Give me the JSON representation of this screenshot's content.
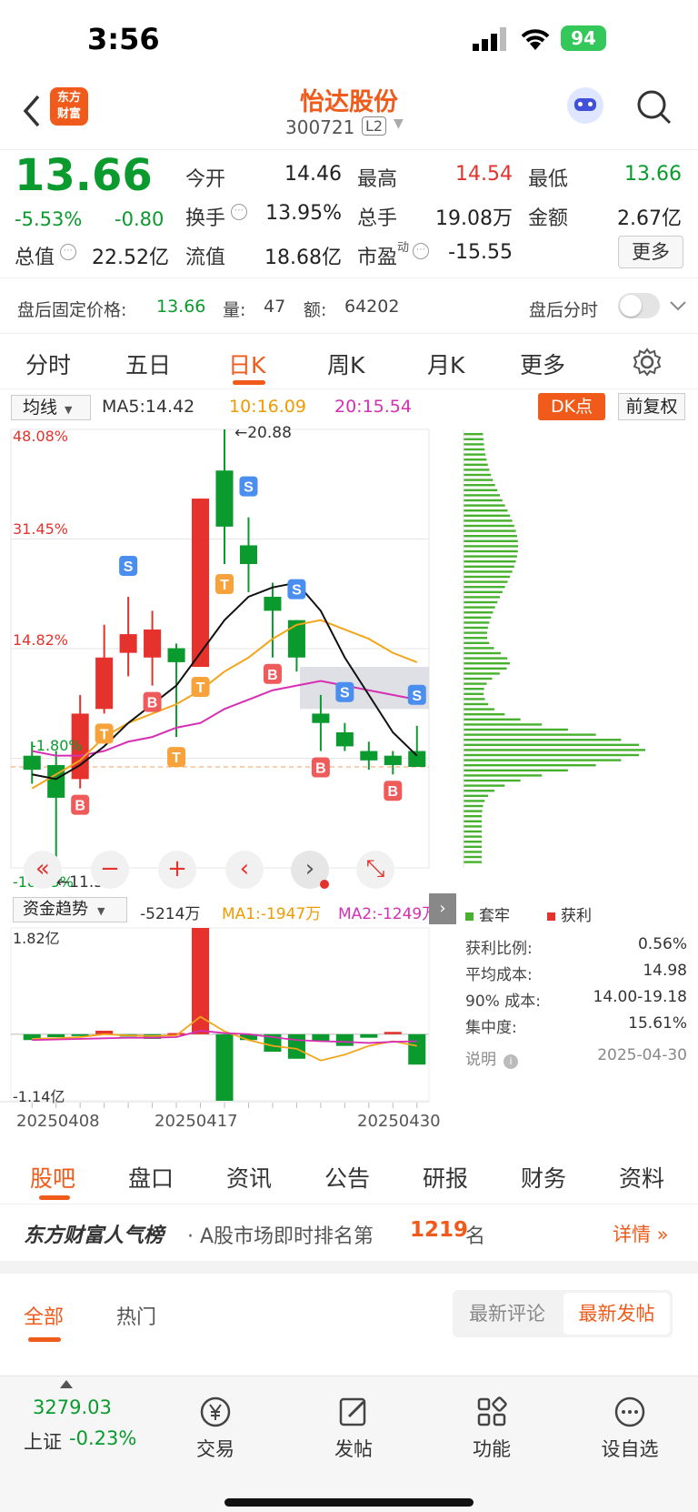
{
  "status_bar": {
    "time": "3:56",
    "battery": "94"
  },
  "header": {
    "brand_line1": "东方",
    "brand_line2": "财富",
    "stock_name": "怡达股份",
    "stock_code": "300721",
    "level_badge": "L2"
  },
  "quote": {
    "price": "13.66",
    "change_pct": "-5.53%",
    "change": "-0.80",
    "market_cap_label": "总值",
    "market_cap": "22.52亿",
    "rows": [
      [
        {
          "label": "今开",
          "value": "14.46",
          "color": "normal"
        },
        {
          "label": "最高",
          "value": "14.54",
          "color": "red"
        },
        {
          "label": "最低",
          "value": "13.66",
          "color": "green"
        }
      ],
      [
        {
          "label": "换手",
          "value": "13.95%",
          "color": "normal"
        },
        {
          "label": "总手",
          "value": "19.08万",
          "color": "normal"
        },
        {
          "label": "金额",
          "value": "2.67亿",
          "color": "normal"
        }
      ],
      [
        {
          "label": "流值",
          "value": "18.68亿",
          "color": "normal"
        },
        {
          "label": "市盈",
          "value": "-15.55",
          "color": "normal"
        }
      ]
    ],
    "pe_super": "动",
    "more_button": "更多"
  },
  "after_hours": {
    "label": "盘后固定价格:",
    "price": "13.66",
    "vol_label": "量:",
    "vol": "47",
    "amt_label": "额:",
    "amt": "64202",
    "time_label": "盘后分时"
  },
  "period_tabs": [
    "分时",
    "五日",
    "日K",
    "周K",
    "月K",
    "更多"
  ],
  "active_period": "日K",
  "indicators": {
    "ma_select": "均线",
    "ma5": "MA5:14.42",
    "ma10": "10:16.09",
    "ma20": "20:15.54",
    "dk_button": "DK点",
    "adjust_button": "前复权"
  },
  "kline_axis": {
    "top_pct": "48.08%",
    "pct2": "31.45%",
    "pct3": "14.82%",
    "pct4": "-1.80%",
    "bottom_pct": "-18.43%",
    "high_label": "←20.88",
    "low_label": "←11.50"
  },
  "chart_data": {
    "type": "candlestick",
    "candles": [
      {
        "o": 13.9,
        "c": 13.6,
        "h": 14.2,
        "l": 13.3
      },
      {
        "o": 13.7,
        "c": 13.0,
        "h": 14.0,
        "l": 11.5
      },
      {
        "o": 13.4,
        "c": 14.8,
        "h": 15.2,
        "l": 13.2
      },
      {
        "o": 14.9,
        "c": 16.0,
        "h": 16.7,
        "l": 14.8
      },
      {
        "o": 16.1,
        "c": 16.5,
        "h": 17.3,
        "l": 15.6
      },
      {
        "o": 16.0,
        "c": 16.6,
        "h": 17.0,
        "l": 15.4
      },
      {
        "o": 16.2,
        "c": 15.9,
        "h": 16.3,
        "l": 14.3
      },
      {
        "o": 15.8,
        "c": 19.4,
        "h": 19.4,
        "l": 15.8
      },
      {
        "o": 20.0,
        "c": 18.8,
        "h": 20.88,
        "l": 18.0
      },
      {
        "o": 18.4,
        "c": 18.0,
        "h": 19.0,
        "l": 17.4
      },
      {
        "o": 17.3,
        "c": 17.0,
        "h": 17.6,
        "l": 16.0
      },
      {
        "o": 16.8,
        "c": 16.0,
        "h": 16.8,
        "l": 15.7
      },
      {
        "o": 14.8,
        "c": 14.6,
        "h": 15.2,
        "l": 14.0
      },
      {
        "o": 14.4,
        "c": 14.1,
        "h": 14.6,
        "l": 14.0
      },
      {
        "o": 14.0,
        "c": 13.8,
        "h": 14.2,
        "l": 13.6
      },
      {
        "o": 13.9,
        "c": 13.7,
        "h": 14.0,
        "l": 13.5
      },
      {
        "o": 14.0,
        "c": 13.66,
        "h": 14.54,
        "l": 13.66
      }
    ],
    "ma5": [
      13.5,
      13.4,
      13.7,
      14.1,
      14.6,
      15.0,
      15.4,
      16.1,
      16.8,
      17.3,
      17.5,
      17.6,
      17.0,
      16.0,
      15.2,
      14.4,
      13.9
    ],
    "ma10": [
      13.2,
      13.5,
      13.8,
      14.3,
      14.6,
      14.8,
      15.0,
      15.3,
      15.7,
      16.0,
      16.4,
      16.7,
      16.8,
      16.6,
      16.4,
      16.1,
      15.9
    ],
    "ma20": [
      14.0,
      13.9,
      13.9,
      14.0,
      14.2,
      14.3,
      14.5,
      14.6,
      14.9,
      15.1,
      15.3,
      15.4,
      15.5,
      15.4,
      15.3,
      15.2,
      15.1
    ],
    "markers": [
      {
        "i": 4,
        "t": "S"
      },
      {
        "i": 9,
        "t": "S"
      },
      {
        "i": 11,
        "t": "S"
      },
      {
        "i": 13,
        "t": "S"
      },
      {
        "i": 16,
        "t": "S"
      },
      {
        "i": 2,
        "t": "B"
      },
      {
        "i": 5,
        "t": "B"
      },
      {
        "i": 10,
        "t": "B"
      },
      {
        "i": 12,
        "t": "B"
      },
      {
        "i": 15,
        "t": "B"
      },
      {
        "i": 3,
        "t": "T"
      },
      {
        "i": 6,
        "t": "T"
      },
      {
        "i": 7,
        "t": "T"
      },
      {
        "i": 8,
        "t": "T"
      }
    ],
    "fund_flow": [
      {
        "v": -0.1
      },
      {
        "v": -0.05
      },
      {
        "v": -0.02
      },
      {
        "v": 0.06
      },
      {
        "v": -0.04
      },
      {
        "v": -0.08
      },
      {
        "v": 0.02
      },
      {
        "v": 1.82
      },
      {
        "v": -1.14
      },
      {
        "v": -0.1
      },
      {
        "v": -0.3
      },
      {
        "v": -0.42
      },
      {
        "v": -0.12
      },
      {
        "v": -0.2
      },
      {
        "v": -0.06
      },
      {
        "v": 0.04
      },
      {
        "v": -0.52
      }
    ],
    "fund_ma1": [
      -0.08,
      -0.07,
      -0.05,
      0.0,
      -0.02,
      -0.03,
      -0.02,
      0.3,
      0.05,
      -0.1,
      -0.2,
      -0.25,
      -0.45,
      -0.35,
      -0.2,
      -0.12,
      -0.2
    ],
    "fund_ma2": [
      -0.1,
      -0.09,
      -0.08,
      -0.07,
      -0.06,
      -0.06,
      -0.05,
      0.06,
      0.02,
      0.0,
      -0.05,
      -0.1,
      -0.12,
      -0.13,
      -0.15,
      -0.13,
      -0.12
    ],
    "dates": [
      "20250408",
      "20250417",
      "20250430"
    ]
  },
  "fund_panel": {
    "select": "资金趋势",
    "value": "-5214万",
    "ma1": "MA1:-1947万",
    "ma2": "MA2:-1249万",
    "top": "1.82亿",
    "bottom": "-1.14亿"
  },
  "chip_panel": {
    "legend_trapped": "套牢",
    "legend_profit": "获利",
    "rows": [
      {
        "label": "获利比例:",
        "value": "0.56%"
      },
      {
        "label": "平均成本:",
        "value": "14.98"
      },
      {
        "label": "90% 成本:",
        "value": "14.00-19.18"
      },
      {
        "label": "集中度:",
        "value": "15.61%"
      }
    ],
    "note_label": "说明",
    "date": "2025-04-30"
  },
  "content_tabs": [
    "股吧",
    "盘口",
    "资讯",
    "公告",
    "研报",
    "财务",
    "资料"
  ],
  "active_content_tab": "股吧",
  "rank": {
    "brand": "东方财富人气榜",
    "text_prefix": "· A股市场即时排名第",
    "rank": "1219",
    "text_suffix": "名",
    "detail": "详情"
  },
  "post_tabs": {
    "all": "全部",
    "hot": "热门",
    "latest_comment": "最新评论",
    "latest_post": "最新发帖"
  },
  "bottom_nav": {
    "index_value": "3279.03",
    "index_name": "上证",
    "index_change": "-0.23%",
    "items": [
      "交易",
      "发帖",
      "功能",
      "设自选"
    ]
  }
}
